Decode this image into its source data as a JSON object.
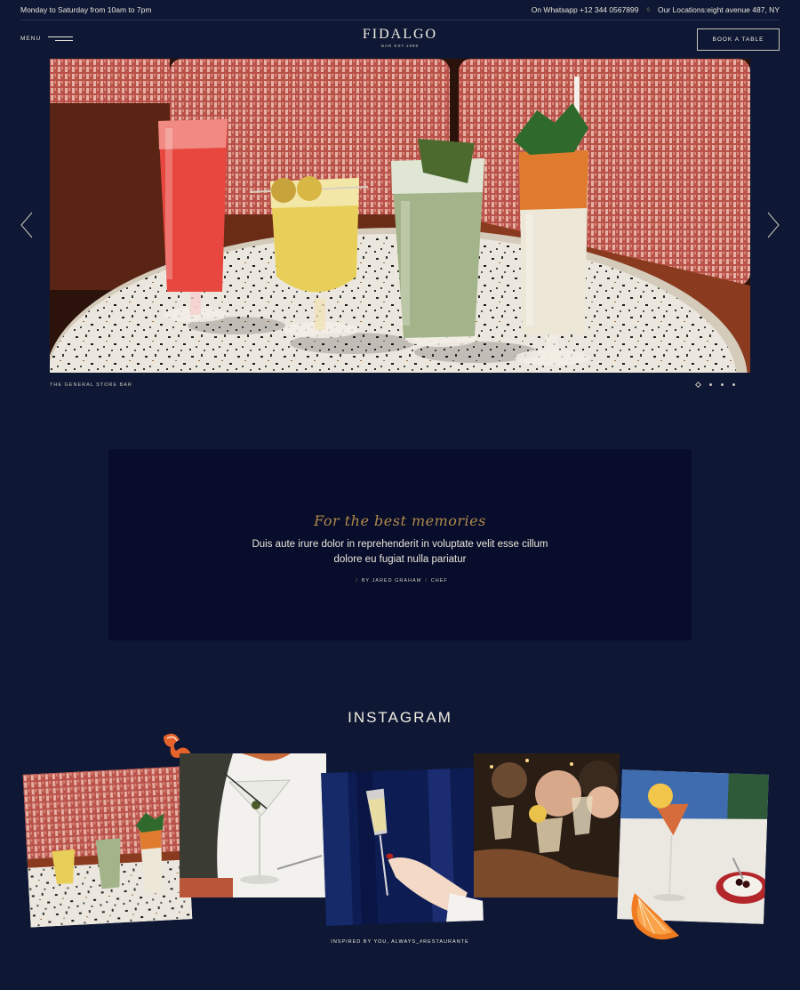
{
  "topbar": {
    "hours": "Monday to Saturday from 10am to 7pm",
    "whatsapp": "On Whatsapp +12 344 0567899",
    "locations": "Our Locations:eight avenue 487, NY"
  },
  "nav": {
    "menu_label": "MENU",
    "logo_name": "FIDALGO",
    "logo_sub": "BAR EST.1989",
    "book_label": "BOOK A TABLE"
  },
  "hero": {
    "caption": "THE GENERAL STORE BAR",
    "slide_count": 4,
    "active_slide": 1
  },
  "quote": {
    "script": "For the best memories",
    "text_line1": "Duis aute irure dolor in reprehenderit in voluptate velit esse cillum",
    "text_line2": "dolore eu fugiat nulla pariatur",
    "author": "BY JARED GRAHAM",
    "role": "CHEF"
  },
  "instagram": {
    "title": "INSTAGRAM",
    "caption": "INSPIRED BY YOU, ALWAYS_#RESTAURANTE"
  },
  "colors": {
    "background": "#0e1733",
    "quote_panel": "#070d2a",
    "accent_gold": "#b0894c"
  }
}
